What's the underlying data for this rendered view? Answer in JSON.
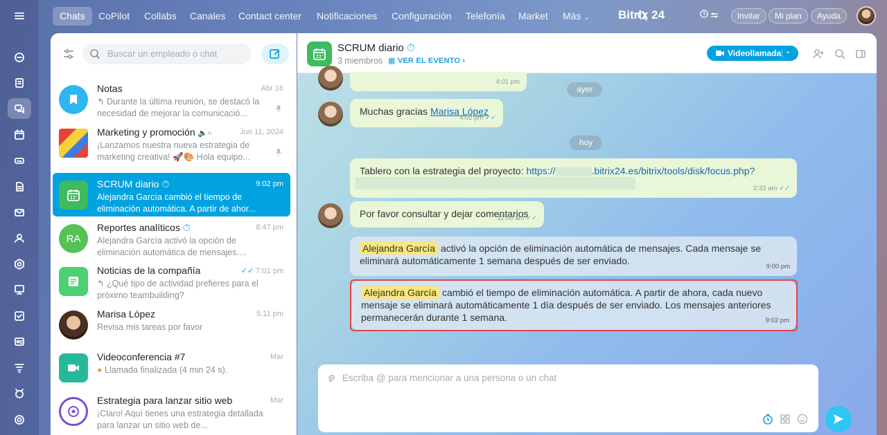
{
  "nav": {
    "items": [
      "Chats",
      "CoPilot",
      "Collabs",
      "Canales",
      "Contact center",
      "Notificaciones",
      "Configuración",
      "Telefonía",
      "Market",
      "Más"
    ],
    "brand": "Bitrix 24",
    "invite": "Invitar",
    "my_plan": "Mi plan",
    "help": "Ayuda"
  },
  "list": {
    "search_placeholder": "Buscar un empleado o chat",
    "chats": [
      {
        "name": "Notas",
        "time": "Abr 16",
        "preview": "↰ Durante la última reunión, se destacó la necesidad de mejorar la comunicació..."
      },
      {
        "name": "Marketing y promoción",
        "time": "Jun 11, 2024",
        "preview": "¡Lanzamos nuestra nueva estrategia de marketing creativa! 🚀🎨 Hola equipo..."
      },
      {
        "name": "SCRUM diario",
        "time": "9:02 pm",
        "preview": "Alejandra García cambió el tiempo de eliminación automática. A partir de ahor..."
      },
      {
        "name": "Reportes analíticos",
        "time": "8:47 pm",
        "preview": "Alejandra García activó la opción de eliminación automática de mensajes....",
        "initials": "RA"
      },
      {
        "name": "Noticias de la compañía",
        "time": "7:01 pm",
        "preview": "↰ ¿Qué tipo de actividad prefieres para el próximo teambuilding?"
      },
      {
        "name": "Marisa López",
        "time": "5:11 pm",
        "preview": "Revisa mis tareas por favor"
      },
      {
        "name": "Videoconferencia #7",
        "time": "Mar",
        "preview": "Llamada finalizada (4 min 24 s)."
      },
      {
        "name": "Estrategia para lanzar sitio web",
        "time": "Mar",
        "preview": "¡Claro! Aquí tienes una estrategia detallada para lanzar un sitio web de..."
      }
    ]
  },
  "chat": {
    "title": "SCRUM diario",
    "members": "3 miembros",
    "event_link": "VER EL EVENTO",
    "video_call": "Videollamada",
    "date_yesterday": "ayer",
    "date_today": "hoy",
    "messages": [
      {
        "time": "4:01 pm"
      },
      {
        "text_before": "Muchas gracias ",
        "mention_link": "Marisa López",
        "time": "4:02 pm"
      },
      {
        "text_before": "Tablero con la estrategia del proyecto: ",
        "link_a": "https://",
        "link_b": ".bitrix24.es/bitrix/tools/disk/focus.php?",
        "time": "2:32 am"
      },
      {
        "text": "Por favor consultar y dejar comentarios",
        "time": "11:00 am"
      },
      {
        "mention": "Alejandra García",
        "text": " activó la opción de eliminación automática de mensajes. Cada mensaje se eliminará automáticamente 1 semana después de ser enviado.",
        "time": "9:00 pm"
      },
      {
        "mention": "Alejandra García",
        "text": " cambió el tiempo de eliminación automática. A partir de ahora, cada nuevo mensaje se eliminará automáticamente 1 día después de ser enviado. Los mensajes anteriores permanecerán durante 1 semana.",
        "time": "9:02 pm"
      }
    ],
    "composer_placeholder": "Escriba @ para mencionar a una persona o un chat"
  },
  "colors": {
    "accent": "#00a2e0",
    "highlight": "#e0454a",
    "bubble": "#e9f7d8",
    "mention": "#fbe77a"
  }
}
